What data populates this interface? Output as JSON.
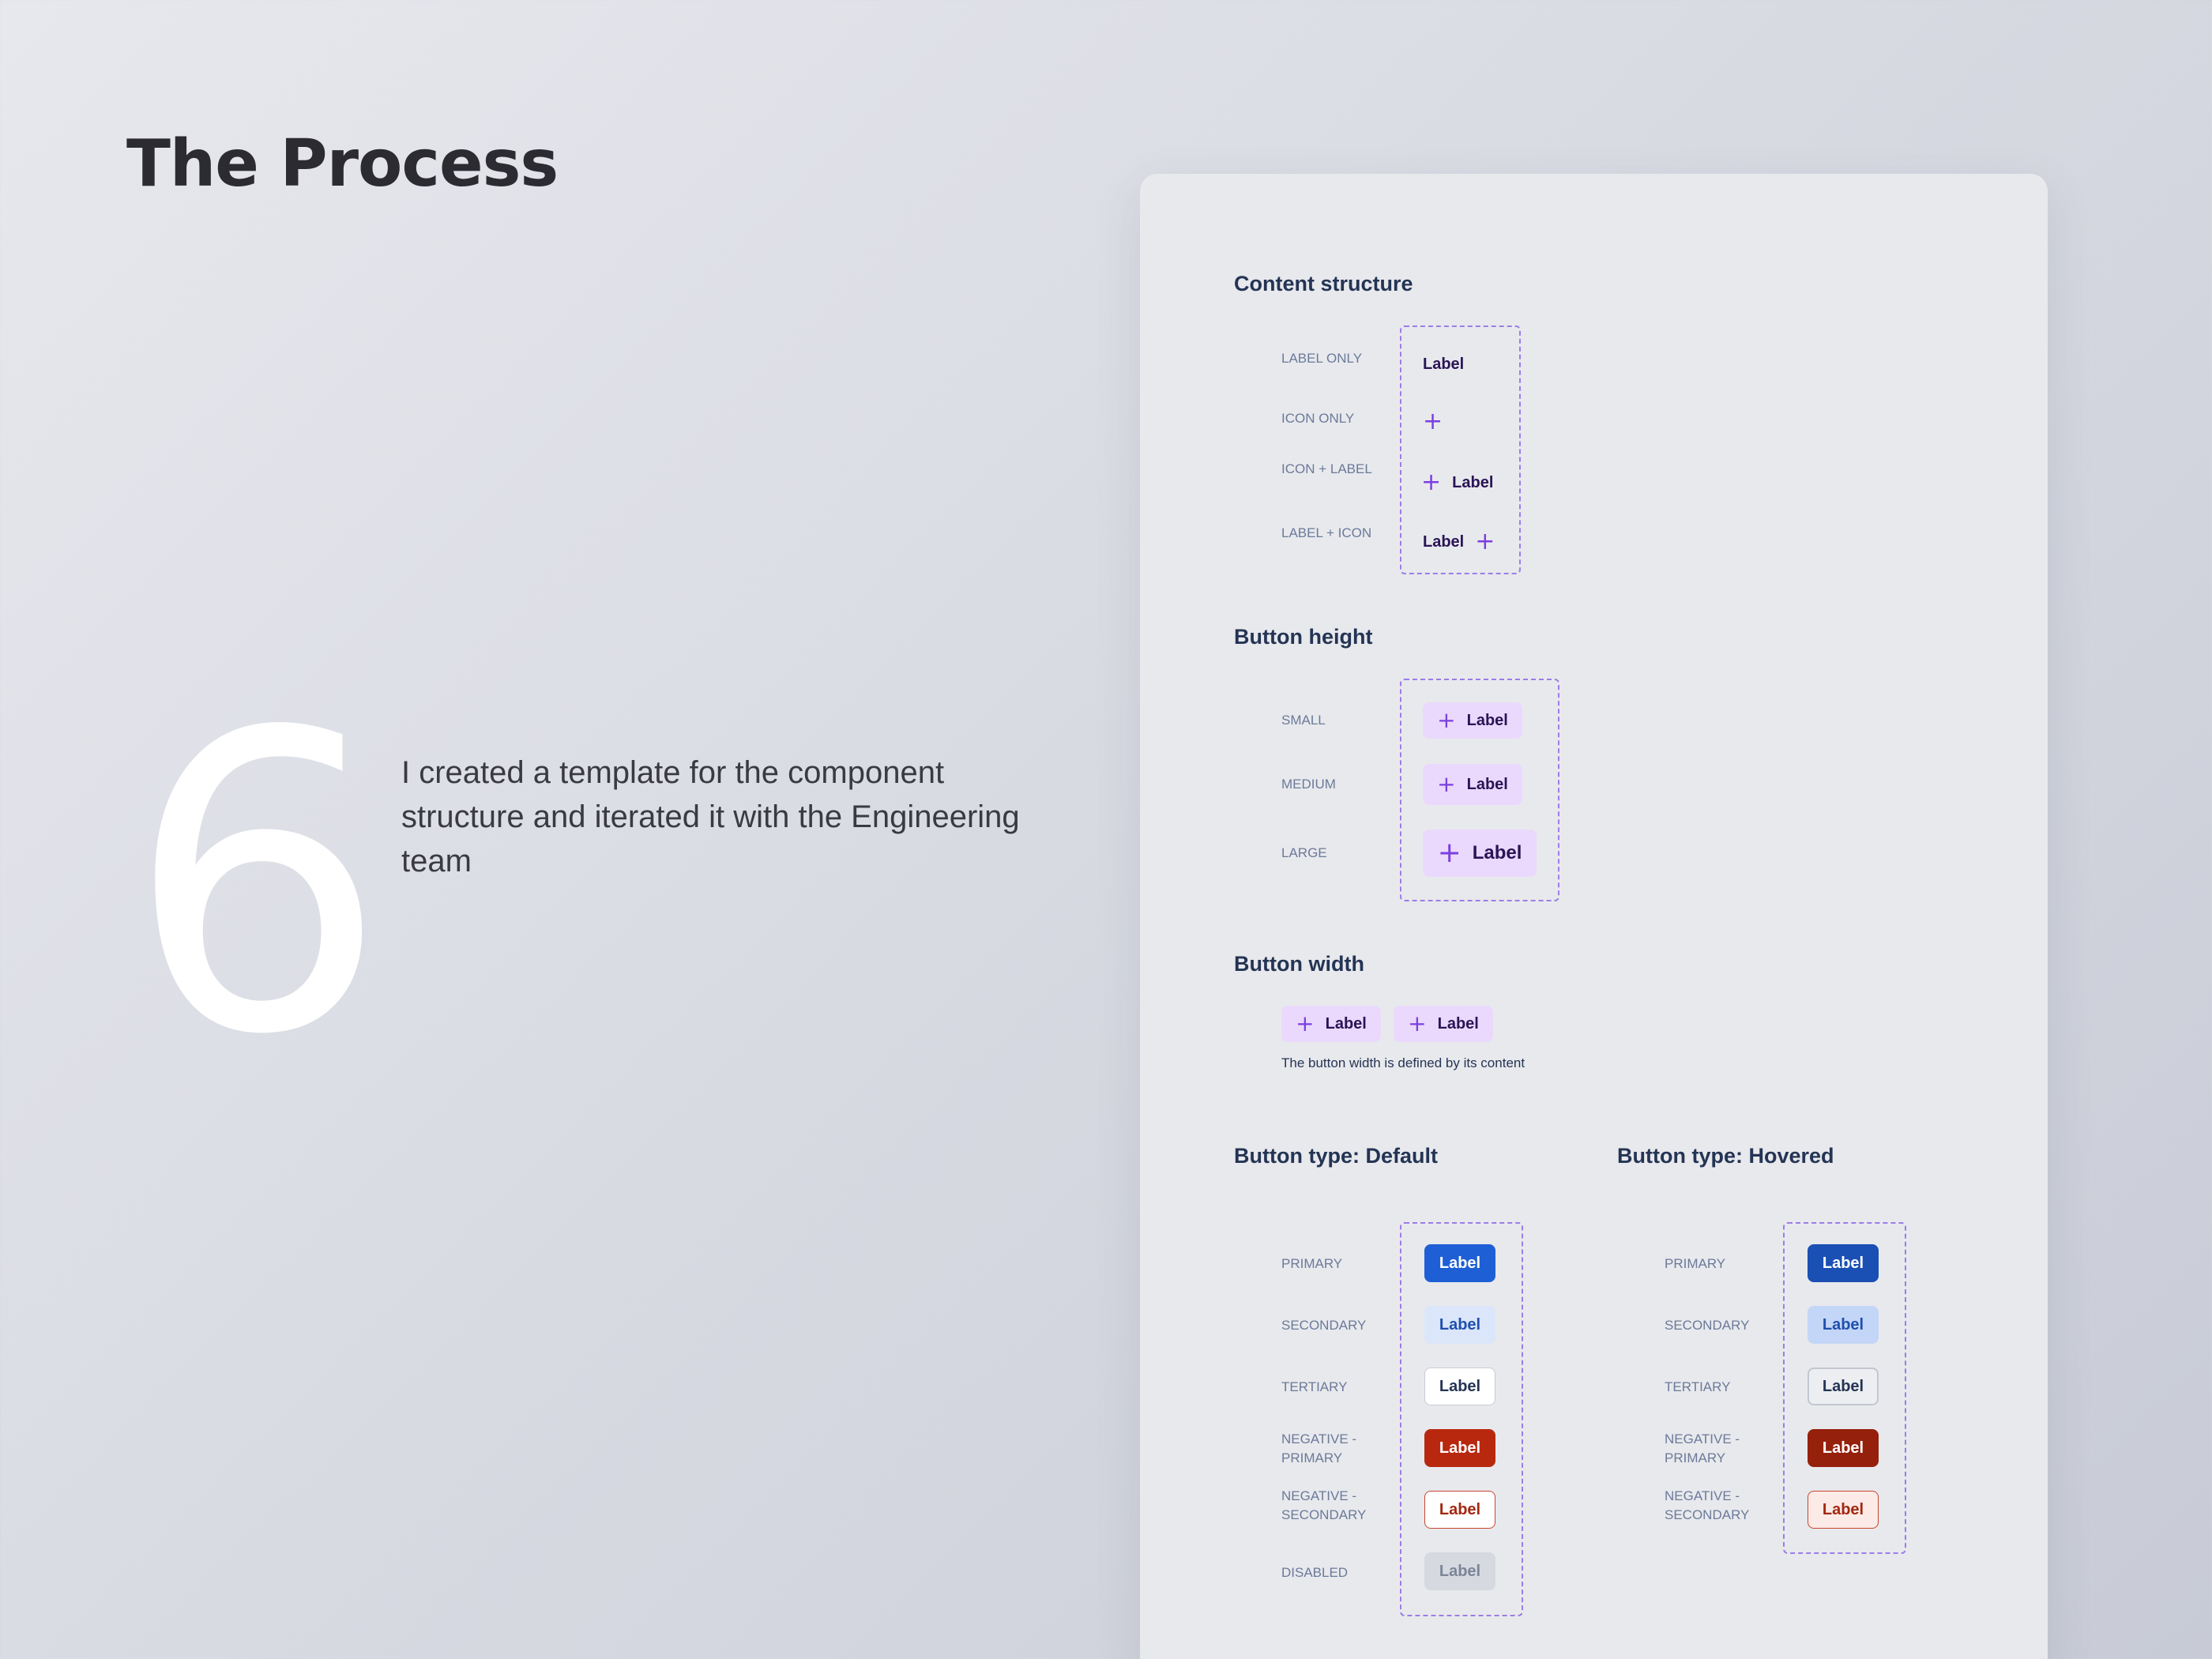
{
  "page": {
    "title": "The Process",
    "step_number": "6",
    "description": "I created a template for the component structure and iterated it with the Engineering team"
  },
  "content_structure": {
    "title": "Content structure",
    "rows": [
      {
        "label": "LABEL ONLY",
        "button": "Label"
      },
      {
        "label": "ICON ONLY"
      },
      {
        "label": "ICON + LABEL",
        "button": "Label"
      },
      {
        "label": "LABEL + ICON",
        "button": "Label"
      }
    ]
  },
  "button_height": {
    "title": "Button height",
    "rows": [
      {
        "label": "SMALL",
        "button": "Label"
      },
      {
        "label": "MEDIUM",
        "button": "Label"
      },
      {
        "label": "LARGE",
        "button": "Label"
      }
    ]
  },
  "button_width": {
    "title": "Button width",
    "buttons": [
      "Label",
      "Label"
    ],
    "note": "The button width is defined by its content"
  },
  "button_type_default": {
    "title": "Button type: Default",
    "rows": [
      {
        "label": "PRIMARY",
        "button": "Label"
      },
      {
        "label": "SECONDARY",
        "button": "Label"
      },
      {
        "label": "TERTIARY",
        "button": "Label"
      },
      {
        "label_line1": "NEGATIVE -",
        "label_line2": "PRIMARY",
        "button": "Label"
      },
      {
        "label_line1": "NEGATIVE -",
        "label_line2": "SECONDARY",
        "button": "Label"
      },
      {
        "label": "DISABLED",
        "button": "Label"
      }
    ]
  },
  "button_type_hovered": {
    "title": "Button type: Hovered",
    "rows": [
      {
        "label": "PRIMARY",
        "button": "Label"
      },
      {
        "label": "SECONDARY",
        "button": "Label"
      },
      {
        "label": "TERTIARY",
        "button": "Label"
      },
      {
        "label_line1": "NEGATIVE -",
        "label_line2": "PRIMARY",
        "button": "Label"
      },
      {
        "label_line1": "NEGATIVE -",
        "label_line2": "SECONDARY",
        "button": "Label"
      }
    ]
  },
  "colors": {
    "accent_purple": "#7b3fe0",
    "pill_background": "#ead9fc",
    "primary_default": "#1f5fd6",
    "primary_hovered": "#1a4fb4",
    "secondary_default": "#dbe6fb",
    "secondary_hovered": "#c4d6f7",
    "negative_default": "#b8280f",
    "negative_hovered": "#95200c",
    "disabled": "#d6d9e0"
  },
  "icons": {
    "plus": "+"
  }
}
